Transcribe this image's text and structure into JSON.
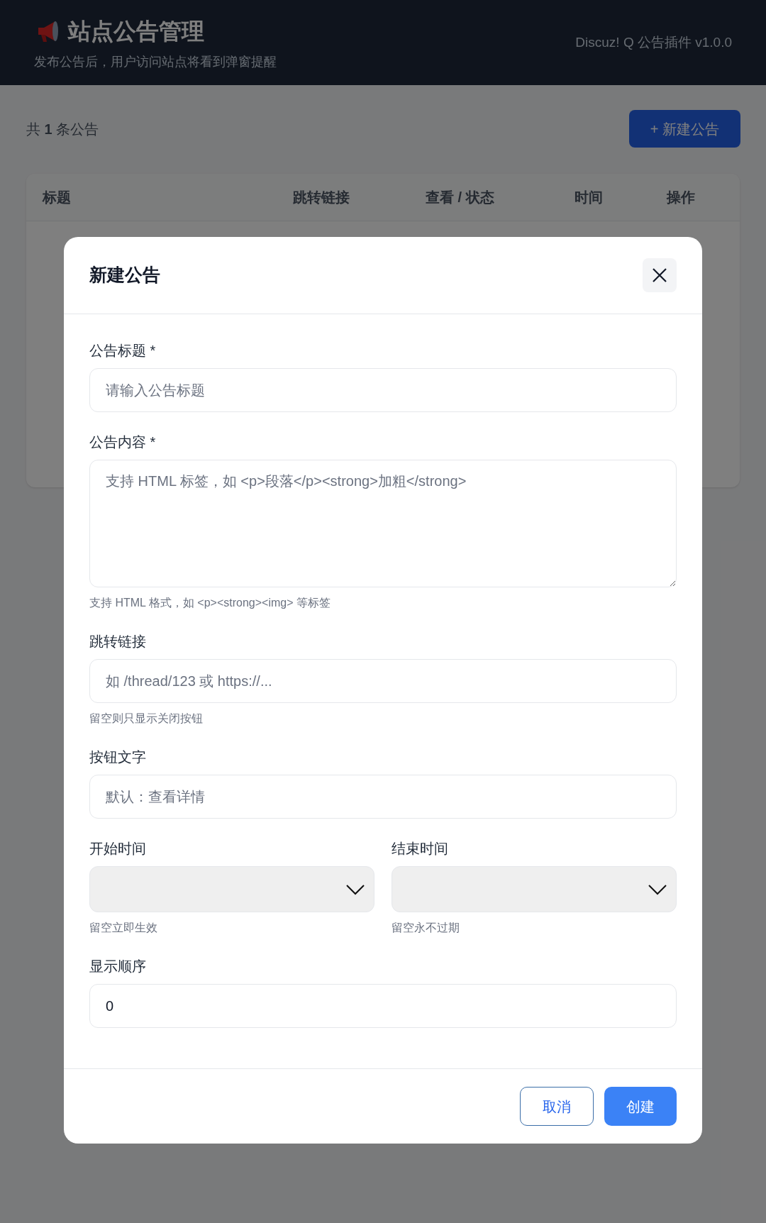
{
  "header": {
    "title": "站点公告管理",
    "subtitle": "发布公告后，用户访问站点将看到弹窗提醒",
    "version": "Discuz! Q 公告插件 v1.0.0"
  },
  "toolbar": {
    "count": "共 **1** 条公告",
    "new_button": "+ 新建公告"
  },
  "table": {
    "columns": [
      "标题",
      "跳转链接",
      "查看 / 状态",
      "时间",
      "操作"
    ]
  },
  "modal": {
    "title": "新建公告",
    "fields": [
      {
        "kind": "input",
        "label": "公告标题 *",
        "placeholder": "请输入公告标题"
      },
      {
        "kind": "textarea",
        "label": "公告内容 *",
        "placeholder": "支持 HTML 标签，如 <p>段落</p><strong>加粗</strong>",
        "help": "支持 HTML 格式，如 <p><strong><img> 等标签"
      },
      {
        "kind": "input",
        "label": "跳转链接",
        "placeholder": "如 /thread/123 或 https://...",
        "help": "留空则只显示关闭按钮"
      },
      {
        "kind": "input",
        "label": "按钮文字",
        "placeholder": "默认：查看详情"
      },
      {
        "kind": "row",
        "items": [
          {
            "kind": "select",
            "label": "开始时间",
            "help": "留空立即生效"
          },
          {
            "kind": "select",
            "label": "结束时间",
            "help": "留空永不过期"
          }
        ]
      },
      {
        "kind": "input",
        "label": "显示顺序",
        "value": "0"
      }
    ],
    "buttons": [
      {
        "kind": "secondary",
        "label": "取消"
      },
      {
        "kind": "primary",
        "label": "创建"
      }
    ]
  }
}
